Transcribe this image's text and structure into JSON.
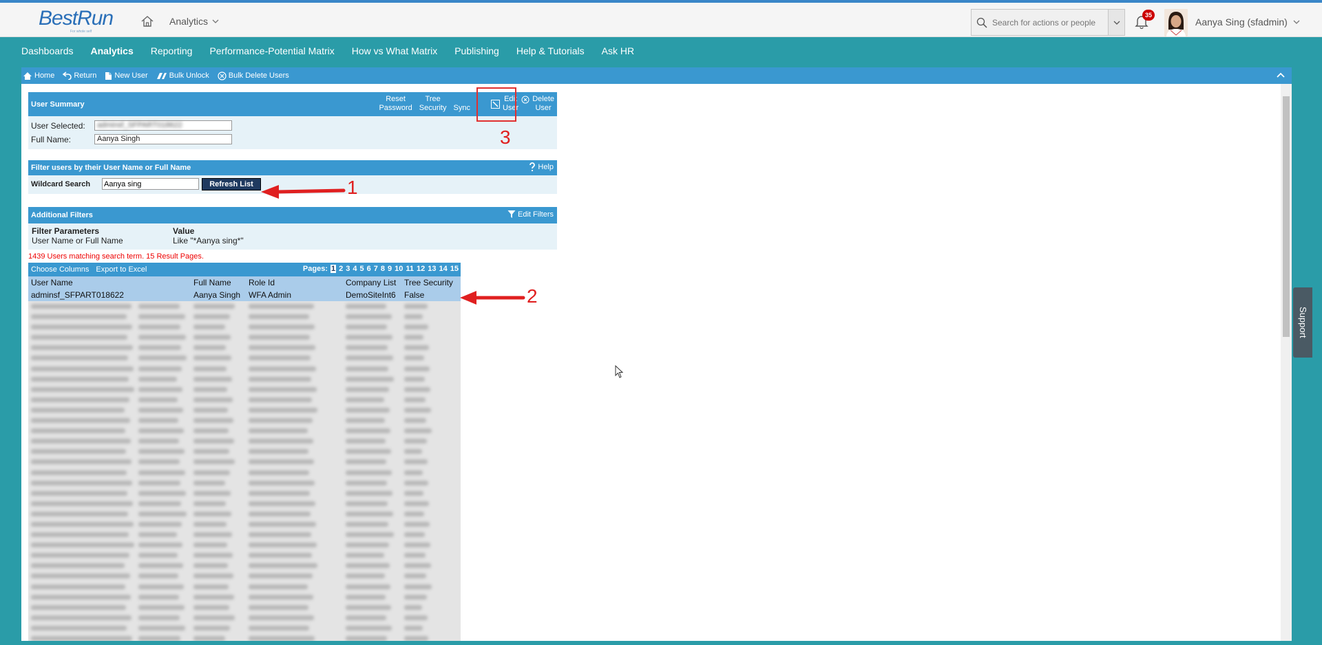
{
  "shell": {
    "logo_text": "BestRun",
    "logo_tagline": "For whole self",
    "module": "Analytics",
    "search_placeholder": "Search for actions or people",
    "notification_count": "35",
    "user_display": "Aanya Sing (sfadmin)"
  },
  "nav": {
    "items": [
      "Dashboards",
      "Analytics",
      "Reporting",
      "Performance-Potential Matrix",
      "How vs What Matrix",
      "Publishing",
      "Help & Tutorials",
      "Ask HR"
    ],
    "active": "Analytics"
  },
  "toolbar": {
    "home": "Home",
    "return": "Return",
    "new_user": "New User",
    "bulk_unlock": "Bulk Unlock",
    "bulk_delete": "Bulk Delete Users"
  },
  "user_summary": {
    "title": "User Summary",
    "actions": {
      "reset_password": [
        "Reset",
        "Password"
      ],
      "tree_security": [
        "Tree",
        "Security"
      ],
      "sync": "Sync",
      "edit_user": [
        "Edit",
        "User"
      ],
      "delete_user": [
        "Delete",
        "User"
      ]
    },
    "user_selected_label": "User Selected:",
    "user_selected_value": "adminsf_SFPART018622",
    "full_name_label": "Full Name:",
    "full_name_value": "Aanya Singh"
  },
  "filter": {
    "title": "Filter users by their User Name or Full Name",
    "help": "Help",
    "wildcard_label": "Wildcard Search",
    "wildcard_value": "Aanya sing",
    "refresh_label": "Refresh List"
  },
  "additional_filters": {
    "title": "Additional Filters",
    "edit": "Edit Filters",
    "param_header": "Filter Parameters",
    "value_header": "Value",
    "param": "User Name or Full Name",
    "value": "Like \"*Aanya sing*\""
  },
  "results": {
    "match_text": "1439 Users matching search term. 15 Result Pages.",
    "choose_columns": "Choose Columns",
    "export": "Export to Excel",
    "pages_label": "Pages:",
    "pages": [
      "1",
      "2",
      "3",
      "4",
      "5",
      "6",
      "7",
      "8",
      "9",
      "10",
      "11",
      "12",
      "13",
      "14",
      "15"
    ],
    "current_page": "1",
    "columns": [
      "User Name",
      "Full Name",
      "Role Id",
      "Company List",
      "Tree Security"
    ],
    "selected_row": [
      "adminsf_SFPART018622",
      "Aanya Singh",
      "WFA Admin",
      "DemoSiteInt6",
      "False"
    ]
  },
  "annotations": {
    "one": "1",
    "two": "2",
    "three": "3"
  },
  "support": "Support",
  "colors": {
    "accent_blue": "#3a98d0",
    "teal_bg": "#2a9ca8",
    "annotation_red": "#e02020"
  }
}
